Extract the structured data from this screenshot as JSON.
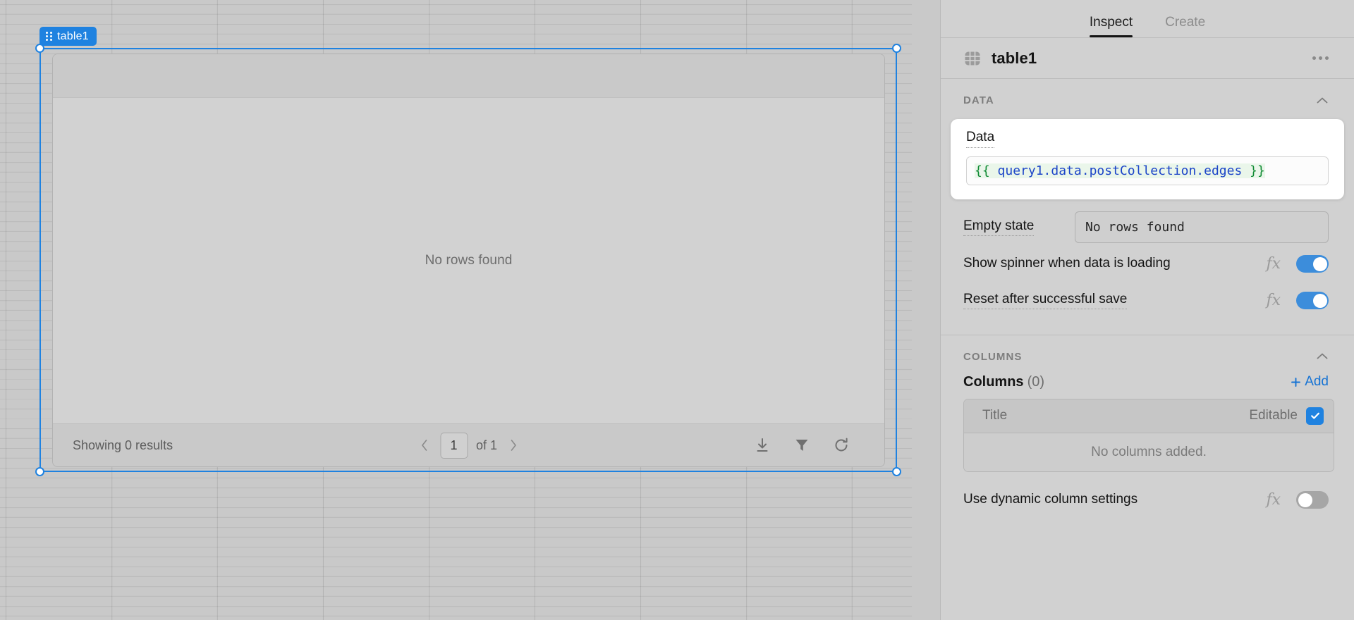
{
  "canvas": {
    "selection_badge": {
      "label": "table1",
      "icon": "drag-handle-icon",
      "color": "#1f82e0"
    },
    "table_widget": {
      "empty_text": "No rows found",
      "footer": {
        "results_text": "Showing 0 results",
        "prev_icon": "chevron-left-icon",
        "page_value": "1",
        "of_text": "of 1",
        "next_icon": "chevron-right-icon",
        "actions": [
          {
            "name": "download-icon",
            "title": "Download"
          },
          {
            "name": "filter-icon",
            "title": "Filter"
          },
          {
            "name": "refresh-icon",
            "title": "Refresh"
          }
        ]
      }
    }
  },
  "inspector": {
    "tabs": [
      {
        "label": "Inspect",
        "active": true
      },
      {
        "label": "Create",
        "active": false
      }
    ],
    "component": {
      "icon": "table-grid-icon",
      "name": "table1",
      "menu_icon": "more-horizontal-icon"
    },
    "sections": {
      "data": {
        "title": "DATA",
        "collapse_icon": "chevron-up-icon",
        "data_field": {
          "label": "Data",
          "code_open": "{{",
          "code_expr": " query1.data.postCollection.edges ",
          "code_close": "}}",
          "brace_color": "#0f8a33",
          "path_color": "#1b44c8"
        },
        "empty_state": {
          "label": "Empty state",
          "value": "No rows found"
        },
        "show_spinner": {
          "label": "Show spinner when data is loading",
          "fx": "fx",
          "toggle": "on"
        },
        "reset_after_save": {
          "label": "Reset after successful save",
          "fx": "fx",
          "toggle": "on"
        }
      },
      "columns": {
        "title": "COLUMNS",
        "collapse_icon": "chevron-up-icon",
        "columns_title": "Columns",
        "columns_count": "(0)",
        "add_label": "Add",
        "add_icon": "plus-icon",
        "table_header": {
          "title_col": "Title",
          "editable_col": "Editable",
          "editable_checked": true
        },
        "empty_message": "No columns added.",
        "dynamic_settings": {
          "label": "Use dynamic column settings",
          "fx": "fx",
          "toggle": "off"
        }
      }
    }
  }
}
